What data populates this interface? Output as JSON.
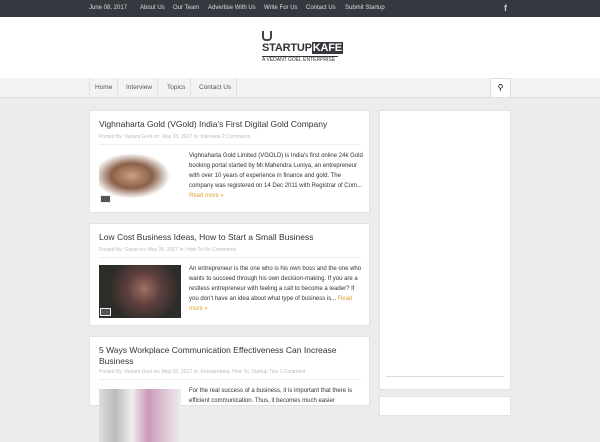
{
  "topbar": {
    "date": "June 08, 2017",
    "links": [
      "About Us",
      "Our Team",
      "Advertise With Us",
      "Write For Us",
      "Contact Us",
      "Submit Startup"
    ],
    "social": "f"
  },
  "logo": {
    "part1": "STARTUP",
    "part2": "KAFE",
    "tagline": "A VEDANT GOEL ENTERPRISE"
  },
  "nav": {
    "items": [
      "Home",
      "Interview",
      "Topics",
      "Contact Us"
    ],
    "search_icon": "search-icon"
  },
  "posts": [
    {
      "title": "Vighnaharta Gold (VGold) India's First Digital Gold Company",
      "meta": "Posted By: Vedant Goel   on: May 28, 2017   In: Interview   2 Comments",
      "excerpt": "Vighnaharta Gold Limited (VGOLD) is India's first online 24k Gold booking portal started by Mr.Mahendra Luniya, an entrepreneur with over 10 years of experience in finance and gold. The company was registered on 14 Dec 2011 with Registrar of Com...",
      "read_more": "Read more »"
    },
    {
      "title": "Low Cost Business Ideas, How to Start a Small Business",
      "meta": "Posted By: Guest   on: May 26, 2017   In: How To   No Comments",
      "excerpt": "An entrepreneur is the one who is his own boss and the one who wants to succeed through his own decision-making. If you are a restless entrepreneur with feeling a call to become a leader? If you don't have an idea about what type of business is...",
      "read_more": "Read more »"
    },
    {
      "title": "5 Ways Workplace Communication Effectiveness Can Increase Business",
      "meta": "Posted By: Vedant Goel   on: May 26, 2017   In: Entrepreneur, How To, Startup Tips   1 Comment",
      "excerpt": "For the real success of a business, it is important that there is efficient communication. Thus, it becomes much easier"
    }
  ]
}
